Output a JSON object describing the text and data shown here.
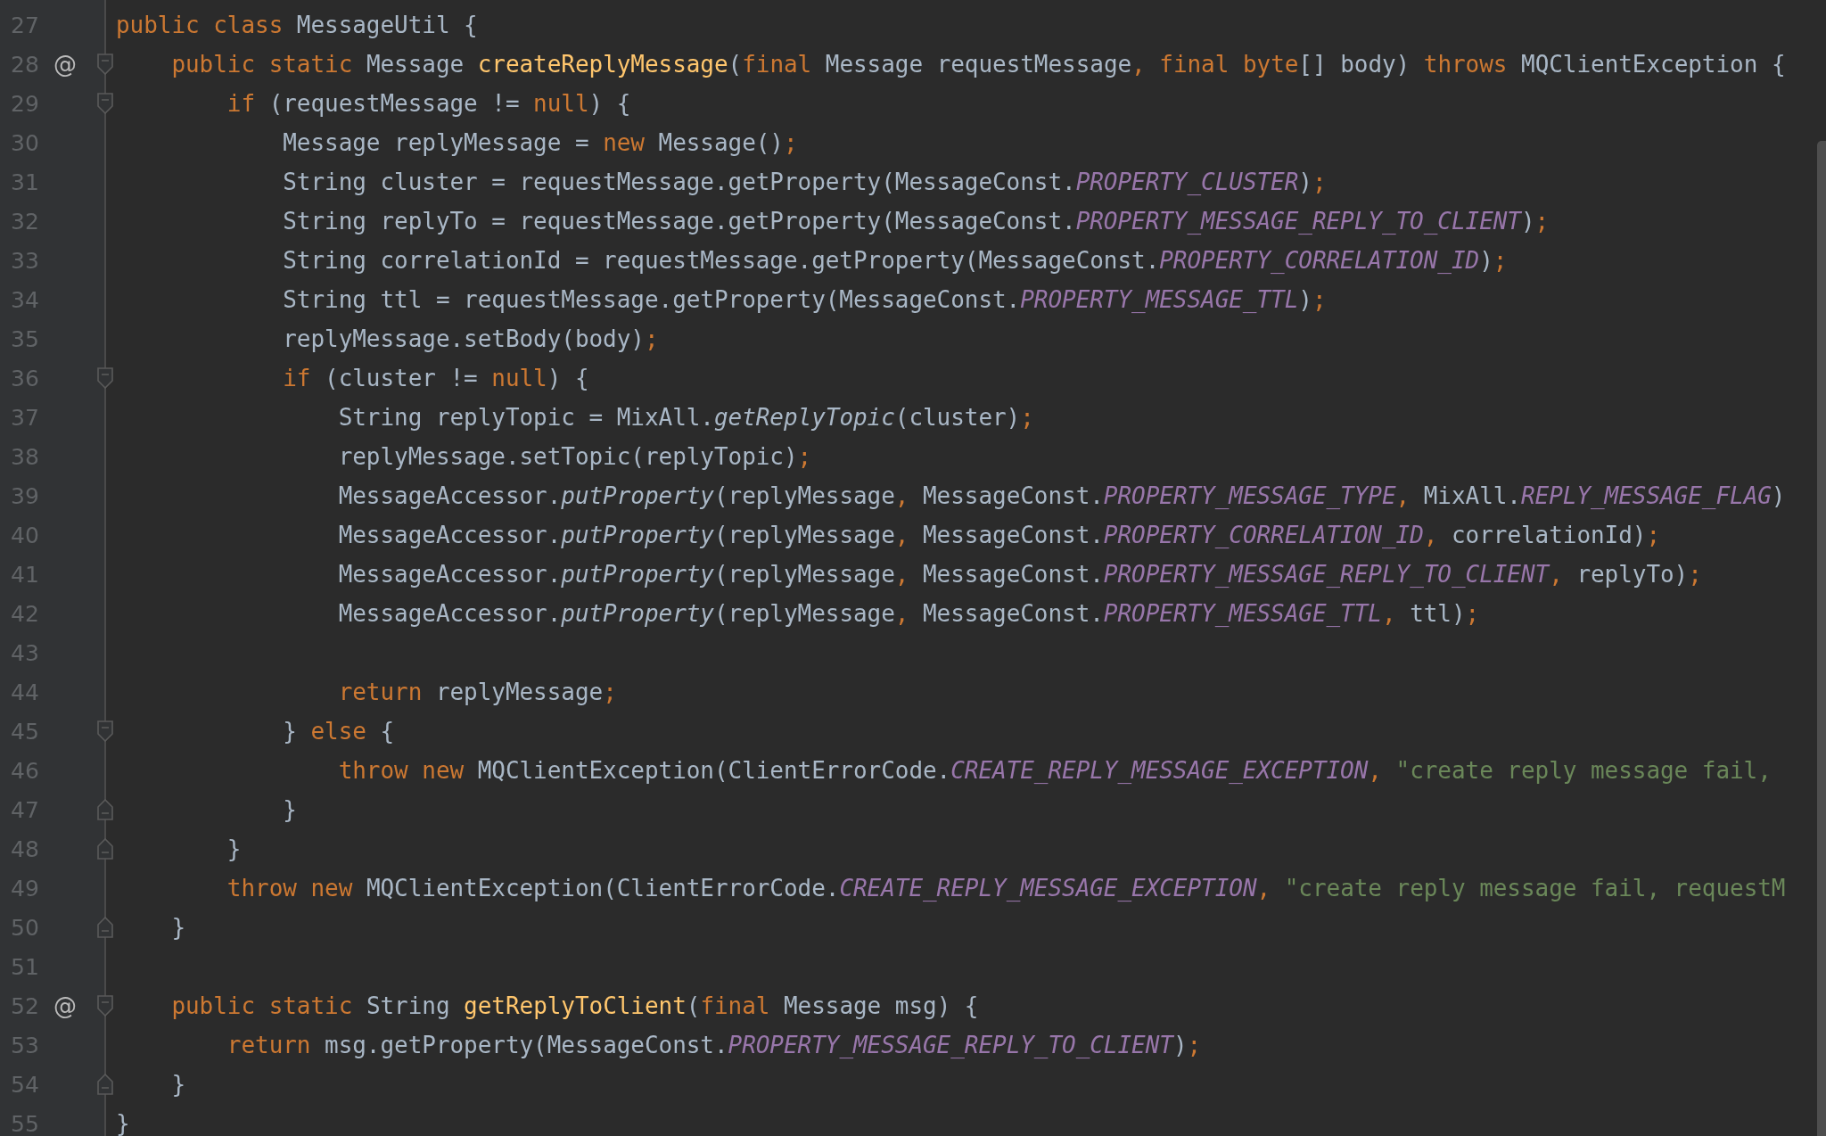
{
  "editor": {
    "lines": [
      {
        "number": "27",
        "tokens": [
          {
            "kind": "kw",
            "text": "public class "
          },
          {
            "kind": "txt",
            "text": "MessageUtil {"
          }
        ]
      },
      {
        "number": "28",
        "marker": "@",
        "fold_start": true,
        "tokens": [
          {
            "kind": "kw",
            "text": "    public static "
          },
          {
            "kind": "txt",
            "text": "Message "
          },
          {
            "kind": "decl",
            "text": "createReplyMessage"
          },
          {
            "kind": "txt",
            "text": "("
          },
          {
            "kind": "kw",
            "text": "final "
          },
          {
            "kind": "txt",
            "text": "Message requestMessage"
          },
          {
            "kind": "punct",
            "text": ", "
          },
          {
            "kind": "kw",
            "text": "final byte"
          },
          {
            "kind": "txt",
            "text": "[] body) "
          },
          {
            "kind": "kw",
            "text": "throws "
          },
          {
            "kind": "txt",
            "text": "MQClientException {"
          }
        ]
      },
      {
        "number": "29",
        "fold_start": true,
        "tokens": [
          {
            "kind": "kw",
            "text": "        if "
          },
          {
            "kind": "txt",
            "text": "(requestMessage != "
          },
          {
            "kind": "kw",
            "text": "null"
          },
          {
            "kind": "txt",
            "text": ") {"
          }
        ]
      },
      {
        "number": "30",
        "tokens": [
          {
            "kind": "txt",
            "text": "            Message replyMessage = "
          },
          {
            "kind": "kw",
            "text": "new "
          },
          {
            "kind": "txt",
            "text": "Message()"
          },
          {
            "kind": "punct",
            "text": ";"
          }
        ]
      },
      {
        "number": "31",
        "tokens": [
          {
            "kind": "txt",
            "text": "            String cluster = requestMessage.getProperty(MessageConst."
          },
          {
            "kind": "const",
            "text": "PROPERTY_CLUSTER"
          },
          {
            "kind": "txt",
            "text": ")"
          },
          {
            "kind": "punct",
            "text": ";"
          }
        ]
      },
      {
        "number": "32",
        "tokens": [
          {
            "kind": "txt",
            "text": "            String replyTo = requestMessage.getProperty(MessageConst."
          },
          {
            "kind": "const",
            "text": "PROPERTY_MESSAGE_REPLY_TO_CLIENT"
          },
          {
            "kind": "txt",
            "text": ")"
          },
          {
            "kind": "punct",
            "text": ";"
          }
        ]
      },
      {
        "number": "33",
        "tokens": [
          {
            "kind": "txt",
            "text": "            String correlationId = requestMessage.getProperty(MessageConst."
          },
          {
            "kind": "const",
            "text": "PROPERTY_CORRELATION_ID"
          },
          {
            "kind": "txt",
            "text": ")"
          },
          {
            "kind": "punct",
            "text": ";"
          }
        ]
      },
      {
        "number": "34",
        "tokens": [
          {
            "kind": "txt",
            "text": "            String ttl = requestMessage.getProperty(MessageConst."
          },
          {
            "kind": "const",
            "text": "PROPERTY_MESSAGE_TTL"
          },
          {
            "kind": "txt",
            "text": ")"
          },
          {
            "kind": "punct",
            "text": ";"
          }
        ]
      },
      {
        "number": "35",
        "tokens": [
          {
            "kind": "txt",
            "text": "            replyMessage.setBody(body)"
          },
          {
            "kind": "punct",
            "text": ";"
          }
        ]
      },
      {
        "number": "36",
        "fold_start": true,
        "tokens": [
          {
            "kind": "kw",
            "text": "            if "
          },
          {
            "kind": "txt",
            "text": "(cluster != "
          },
          {
            "kind": "kw",
            "text": "null"
          },
          {
            "kind": "txt",
            "text": ") {"
          }
        ]
      },
      {
        "number": "37",
        "tokens": [
          {
            "kind": "txt",
            "text": "                String replyTopic = MixAll."
          },
          {
            "kind": "call",
            "text": "getReplyTopic"
          },
          {
            "kind": "txt",
            "text": "(cluster)"
          },
          {
            "kind": "punct",
            "text": ";"
          }
        ]
      },
      {
        "number": "38",
        "tokens": [
          {
            "kind": "txt",
            "text": "                replyMessage.setTopic(replyTopic)"
          },
          {
            "kind": "punct",
            "text": ";"
          }
        ]
      },
      {
        "number": "39",
        "tokens": [
          {
            "kind": "txt",
            "text": "                MessageAccessor."
          },
          {
            "kind": "call",
            "text": "putProperty"
          },
          {
            "kind": "txt",
            "text": "(replyMessage"
          },
          {
            "kind": "punct",
            "text": ", "
          },
          {
            "kind": "txt",
            "text": "MessageConst."
          },
          {
            "kind": "const",
            "text": "PROPERTY_MESSAGE_TYPE"
          },
          {
            "kind": "punct",
            "text": ", "
          },
          {
            "kind": "txt",
            "text": "MixAll."
          },
          {
            "kind": "const",
            "text": "REPLY_MESSAGE_FLAG"
          },
          {
            "kind": "txt",
            "text": ")"
          }
        ]
      },
      {
        "number": "40",
        "tokens": [
          {
            "kind": "txt",
            "text": "                MessageAccessor."
          },
          {
            "kind": "call",
            "text": "putProperty"
          },
          {
            "kind": "txt",
            "text": "(replyMessage"
          },
          {
            "kind": "punct",
            "text": ", "
          },
          {
            "kind": "txt",
            "text": "MessageConst."
          },
          {
            "kind": "const",
            "text": "PROPERTY_CORRELATION_ID"
          },
          {
            "kind": "punct",
            "text": ", "
          },
          {
            "kind": "txt",
            "text": "correlationId)"
          },
          {
            "kind": "punct",
            "text": ";"
          }
        ]
      },
      {
        "number": "41",
        "tokens": [
          {
            "kind": "txt",
            "text": "                MessageAccessor."
          },
          {
            "kind": "call",
            "text": "putProperty"
          },
          {
            "kind": "txt",
            "text": "(replyMessage"
          },
          {
            "kind": "punct",
            "text": ", "
          },
          {
            "kind": "txt",
            "text": "MessageConst."
          },
          {
            "kind": "const",
            "text": "PROPERTY_MESSAGE_REPLY_TO_CLIENT"
          },
          {
            "kind": "punct",
            "text": ", "
          },
          {
            "kind": "txt",
            "text": "replyTo)"
          },
          {
            "kind": "punct",
            "text": ";"
          }
        ]
      },
      {
        "number": "42",
        "tokens": [
          {
            "kind": "txt",
            "text": "                MessageAccessor."
          },
          {
            "kind": "call",
            "text": "putProperty"
          },
          {
            "kind": "txt",
            "text": "(replyMessage"
          },
          {
            "kind": "punct",
            "text": ", "
          },
          {
            "kind": "txt",
            "text": "MessageConst."
          },
          {
            "kind": "const",
            "text": "PROPERTY_MESSAGE_TTL"
          },
          {
            "kind": "punct",
            "text": ", "
          },
          {
            "kind": "txt",
            "text": "ttl)"
          },
          {
            "kind": "punct",
            "text": ";"
          }
        ]
      },
      {
        "number": "43"
      },
      {
        "number": "44",
        "tokens": [
          {
            "kind": "kw",
            "text": "                return "
          },
          {
            "kind": "txt",
            "text": "replyMessage"
          },
          {
            "kind": "punct",
            "text": ";"
          }
        ]
      },
      {
        "number": "45",
        "fold_start": true,
        "tokens": [
          {
            "kind": "txt",
            "text": "            } "
          },
          {
            "kind": "kw",
            "text": "else "
          },
          {
            "kind": "txt",
            "text": "{"
          }
        ]
      },
      {
        "number": "46",
        "tokens": [
          {
            "kind": "kw",
            "text": "                throw new "
          },
          {
            "kind": "txt",
            "text": "MQClientException(ClientErrorCode."
          },
          {
            "kind": "const",
            "text": "CREATE_REPLY_MESSAGE_EXCEPTION"
          },
          {
            "kind": "punct",
            "text": ", "
          },
          {
            "kind": "str",
            "text": "\"create reply message fail,"
          }
        ]
      },
      {
        "number": "47",
        "fold_end": true,
        "tokens": [
          {
            "kind": "txt",
            "text": "            }"
          }
        ]
      },
      {
        "number": "48",
        "fold_end": true,
        "tokens": [
          {
            "kind": "txt",
            "text": "        }"
          }
        ]
      },
      {
        "number": "49",
        "tokens": [
          {
            "kind": "kw",
            "text": "        throw new "
          },
          {
            "kind": "txt",
            "text": "MQClientException(ClientErrorCode."
          },
          {
            "kind": "const",
            "text": "CREATE_REPLY_MESSAGE_EXCEPTION"
          },
          {
            "kind": "punct",
            "text": ", "
          },
          {
            "kind": "str",
            "text": "\"create reply message fail, requestM"
          }
        ]
      },
      {
        "number": "50",
        "fold_end": true,
        "tokens": [
          {
            "kind": "txt",
            "text": "    }"
          }
        ]
      },
      {
        "number": "51"
      },
      {
        "number": "52",
        "marker": "@",
        "fold_start": true,
        "tokens": [
          {
            "kind": "kw",
            "text": "    public static "
          },
          {
            "kind": "txt",
            "text": "String "
          },
          {
            "kind": "decl",
            "text": "getReplyToClient"
          },
          {
            "kind": "txt",
            "text": "("
          },
          {
            "kind": "kw",
            "text": "final "
          },
          {
            "kind": "txt",
            "text": "Message msg) {"
          }
        ]
      },
      {
        "number": "53",
        "tokens": [
          {
            "kind": "kw",
            "text": "        return "
          },
          {
            "kind": "txt",
            "text": "msg.getProperty(MessageConst."
          },
          {
            "kind": "const",
            "text": "PROPERTY_MESSAGE_REPLY_TO_CLIENT"
          },
          {
            "kind": "txt",
            "text": ")"
          },
          {
            "kind": "punct",
            "text": ";"
          }
        ]
      },
      {
        "number": "54",
        "fold_end": true,
        "tokens": [
          {
            "kind": "txt",
            "text": "    }"
          }
        ]
      },
      {
        "number": "55",
        "tokens": [
          {
            "kind": "txt",
            "text": "}"
          }
        ]
      }
    ]
  }
}
